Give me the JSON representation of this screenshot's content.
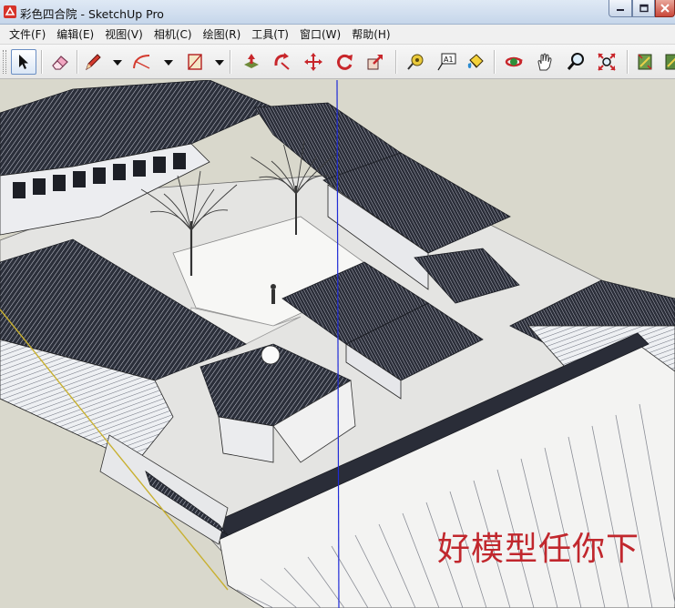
{
  "window": {
    "title": "彩色四合院 - SketchUp Pro",
    "controls": [
      "minimize",
      "maximize",
      "close"
    ]
  },
  "menus": [
    {
      "label": "文件(F)"
    },
    {
      "label": "编辑(E)"
    },
    {
      "label": "视图(V)"
    },
    {
      "label": "相机(C)"
    },
    {
      "label": "绘图(R)"
    },
    {
      "label": "工具(T)"
    },
    {
      "label": "窗口(W)"
    },
    {
      "label": "帮助(H)"
    }
  ],
  "toolbar": {
    "tools": [
      {
        "name": "select-icon",
        "active": true
      },
      {
        "name": "eraser-icon"
      },
      {
        "name": "pencil-icon",
        "dropdown": true
      },
      {
        "name": "arc-icon",
        "dropdown": true
      },
      {
        "name": "rectangle-icon",
        "dropdown": true
      },
      {
        "name": "push-pull-icon"
      },
      {
        "name": "rotate-icon"
      },
      {
        "name": "move-icon"
      },
      {
        "name": "follow-me-icon"
      },
      {
        "name": "scale-icon"
      },
      {
        "name": "tape-measure-icon"
      },
      {
        "name": "text-icon",
        "glyph": "A1"
      },
      {
        "name": "paint-bucket-icon"
      },
      {
        "name": "orbit-icon"
      },
      {
        "name": "pan-icon"
      },
      {
        "name": "zoom-icon"
      },
      {
        "name": "zoom-extents-icon"
      },
      {
        "name": "previous-view-icon"
      },
      {
        "name": "next-view-icon"
      }
    ]
  },
  "colors": {
    "viewport_bg": "#d9d8cc",
    "roof": "#2b2f3a",
    "wall": "#e9e9ec",
    "axis_blue": "#1f2bd6",
    "axis_yellow": "#c8b030",
    "watermark": "#c1272d"
  },
  "viewport": {
    "watermark": "好模型任你下"
  }
}
